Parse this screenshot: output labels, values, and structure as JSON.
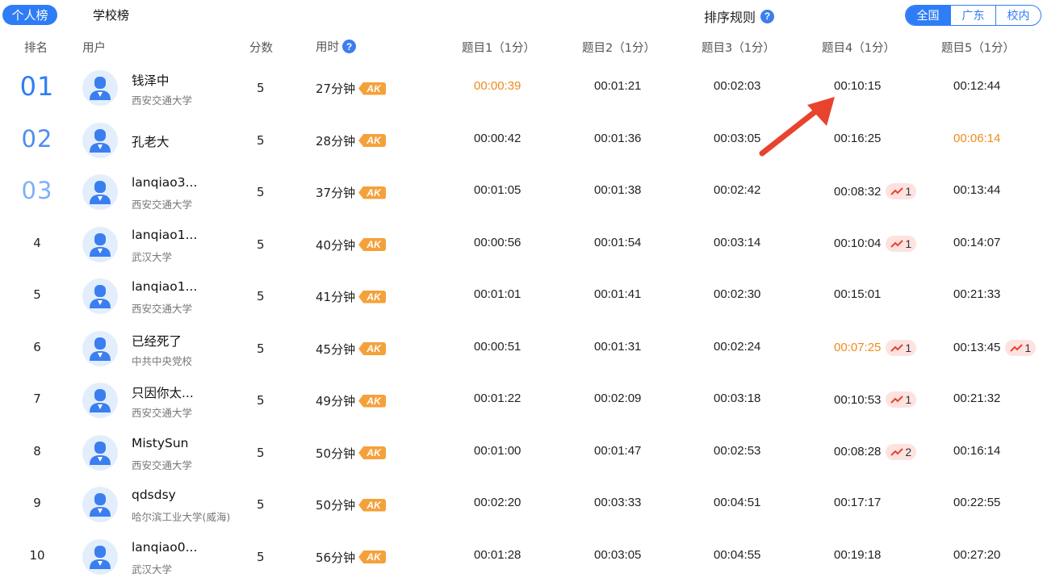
{
  "tabs": {
    "personal": "个人榜",
    "school": "学校榜"
  },
  "sort_rule": {
    "label": "排序规则",
    "help": "?"
  },
  "region": {
    "national": "全国",
    "guangdong": "广东",
    "campus": "校内"
  },
  "headers": {
    "rank": "排名",
    "user": "用户",
    "score": "分数",
    "time": "用时",
    "time_help": "?",
    "q1": "题目1（1分）",
    "q2": "题目2（1分）",
    "q3": "题目3（1分）",
    "q4": "题目4（1分）",
    "q5": "题目5（1分）"
  },
  "ak_label": "AK",
  "rows": [
    {
      "rank": "01",
      "name": "钱泽中",
      "school": "西安交通大学",
      "score": "5",
      "time": "27分钟",
      "q1": "00:00:39",
      "q2": "00:01:21",
      "q3": "00:02:03",
      "q4": "00:10:15",
      "q5": "00:12:44",
      "q4_up": "",
      "q5_up": ""
    },
    {
      "rank": "02",
      "name": "孔老大",
      "school": "",
      "score": "5",
      "time": "28分钟",
      "q1": "00:00:42",
      "q2": "00:01:36",
      "q3": "00:03:05",
      "q4": "00:16:25",
      "q5": "00:06:14",
      "q4_up": "",
      "q5_up": ""
    },
    {
      "rank": "03",
      "name": "lanqiao3...",
      "school": "西安交通大学",
      "score": "5",
      "time": "37分钟",
      "q1": "00:01:05",
      "q2": "00:01:38",
      "q3": "00:02:42",
      "q4": "00:08:32",
      "q5": "00:13:44",
      "q4_up": "1",
      "q5_up": ""
    },
    {
      "rank": "4",
      "name": "lanqiao1...",
      "school": "武汉大学",
      "score": "5",
      "time": "40分钟",
      "q1": "00:00:56",
      "q2": "00:01:54",
      "q3": "00:03:14",
      "q4": "00:10:04",
      "q5": "00:14:07",
      "q4_up": "1",
      "q5_up": ""
    },
    {
      "rank": "5",
      "name": "lanqiao1...",
      "school": "西安交通大学",
      "score": "5",
      "time": "41分钟",
      "q1": "00:01:01",
      "q2": "00:01:41",
      "q3": "00:02:30",
      "q4": "00:15:01",
      "q5": "00:21:33",
      "q4_up": "",
      "q5_up": ""
    },
    {
      "rank": "6",
      "name": "已经死了",
      "school": "中共中央党校",
      "score": "5",
      "time": "45分钟",
      "q1": "00:00:51",
      "q2": "00:01:31",
      "q3": "00:02:24",
      "q4": "00:07:25",
      "q5": "00:13:45",
      "q4_up": "1",
      "q5_up": "1"
    },
    {
      "rank": "7",
      "name": "只因你太...",
      "school": "西安交通大学",
      "score": "5",
      "time": "49分钟",
      "q1": "00:01:22",
      "q2": "00:02:09",
      "q3": "00:03:18",
      "q4": "00:10:53",
      "q5": "00:21:32",
      "q4_up": "1",
      "q5_up": ""
    },
    {
      "rank": "8",
      "name": "MistySun",
      "school": "西安交通大学",
      "score": "5",
      "time": "50分钟",
      "q1": "00:01:00",
      "q2": "00:01:47",
      "q3": "00:02:53",
      "q4": "00:08:28",
      "q5": "00:16:14",
      "q4_up": "2",
      "q5_up": ""
    },
    {
      "rank": "9",
      "name": "qdsdsy",
      "school": "哈尔滨工业大学(威海)",
      "score": "5",
      "time": "50分钟",
      "q1": "00:02:20",
      "q2": "00:03:33",
      "q3": "00:04:51",
      "q4": "00:17:17",
      "q5": "00:22:55",
      "q4_up": "",
      "q5_up": ""
    },
    {
      "rank": "10",
      "name": "lanqiao0...",
      "school": "武汉大学",
      "score": "5",
      "time": "56分钟",
      "q1": "00:01:28",
      "q2": "00:03:05",
      "q3": "00:04:55",
      "q4": "00:19:18",
      "q5": "00:27:20",
      "q4_up": "",
      "q5_up": ""
    }
  ],
  "highlight": {
    "orange": "#f08a1e",
    "accent": "#2f7df6",
    "arrow": "#e8432e"
  }
}
